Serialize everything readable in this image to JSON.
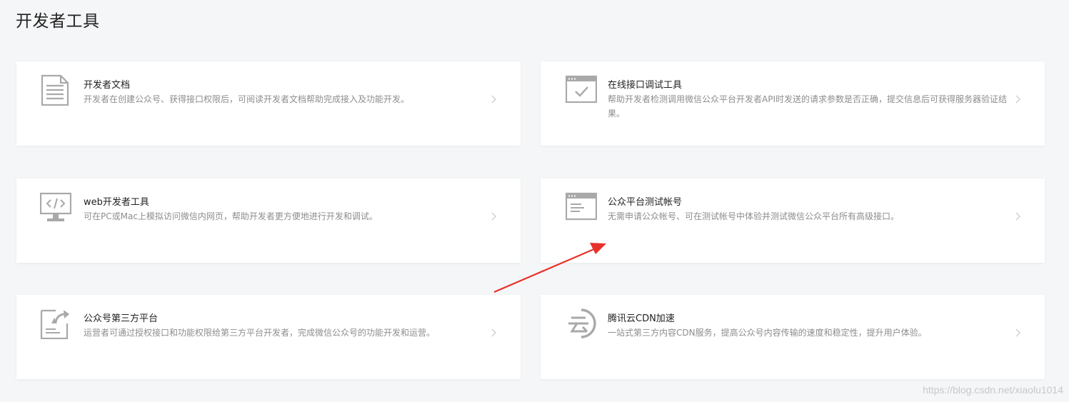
{
  "page": {
    "title": "开发者工具"
  },
  "cards": [
    {
      "title": "开发者文档",
      "desc": "开发者在创建公众号、获得接口权限后，可阅读开发者文档帮助完成接入及功能开发。",
      "icon": "document-icon"
    },
    {
      "title": "在线接口调试工具",
      "desc": "帮助开发者检测调用微信公众平台开发者API时发送的请求参数是否正确，提交信息后可获得服务器验证结果。",
      "icon": "browser-check-icon"
    },
    {
      "title": "web开发者工具",
      "desc": "可在PC或Mac上模拟访问微信内网页，帮助开发者更方便地进行开发和调试。",
      "icon": "monitor-code-icon"
    },
    {
      "title": "公众平台测试帐号",
      "desc": "无需申请公众帐号、可在测试帐号中体验并测试微信公众平台所有高级接口。",
      "icon": "browser-window-icon"
    },
    {
      "title": "公众号第三方平台",
      "desc": "运营者可通过授权接口和功能权限给第三方平台开发者，完成微信公众号的功能开发和运营。",
      "icon": "share-document-icon"
    },
    {
      "title": "腾讯云CDN加速",
      "desc": "一站式第三方内容CDN服务，提高公众号内容传输的速度和稳定性，提升用户体验。",
      "icon": "cloud-cdn-icon"
    }
  ],
  "watermark": "https://blog.csdn.net/xiaolu1014",
  "colors": {
    "background": "#f5f6f7",
    "card": "#ffffff",
    "icon": "#a9a9a9",
    "annotation_arrow": "#e8312a"
  }
}
